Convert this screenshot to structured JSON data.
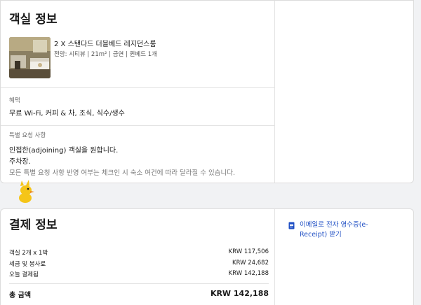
{
  "room": {
    "section_title": "객실 정보",
    "room_name": "2 X 스탠다드 더블베드 레지던스룸",
    "room_details": "전망: 시티뷰 | 21m² | 금연 | 퀸베드 1개",
    "benefits_label": "혜택",
    "benefits_text": "무료 Wi-Fi, 커피 & 차, 조식, 식수/생수",
    "requests_label": "특별 요청 사항",
    "request_1": "인접한(adjoining) 객실을 원합니다.",
    "request_2": "주차장.",
    "requests_note": "모든 특별 요청 사항 반영 여부는 체크인 시 숙소 여건에 따라 달라질 수 있습니다."
  },
  "payment": {
    "section_title": "결제 정보",
    "rows": [
      {
        "label": "객실 2개 x 1박",
        "value": "KRW 117,506"
      },
      {
        "label": "세금 및 봉사료",
        "value": "KRW 24,682"
      },
      {
        "label": "오늘 결제됨",
        "value": "KRW 142,188"
      }
    ],
    "total_label": "총 금액",
    "total_value": "KRW 142,188",
    "receipt_link": "이메일로 전자 영수증(e-Receipt) 받기"
  },
  "colors": {
    "link": "#1f4fc4",
    "background": "#f1f2f4",
    "mascot": "#f5c518"
  }
}
